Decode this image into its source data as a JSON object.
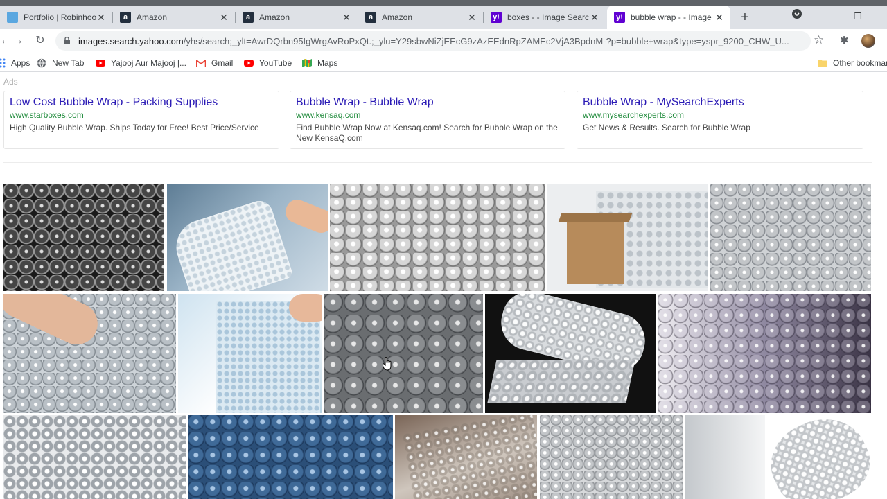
{
  "tabs": [
    {
      "title": "Portfolio | Robinhood",
      "favicon": "robinhood-favicon"
    },
    {
      "title": "Amazon",
      "favicon": "amazon-favicon"
    },
    {
      "title": "Amazon",
      "favicon": "amazon-favicon"
    },
    {
      "title": "Amazon",
      "favicon": "amazon-favicon"
    },
    {
      "title": "boxes - - Image Searc",
      "favicon": "yahoo-favicon"
    },
    {
      "title": "bubble wrap - - Image",
      "favicon": "yahoo-favicon",
      "active": true
    }
  ],
  "toolbar": {
    "url_host": "images.search.yahoo.com",
    "url_rest": "/yhs/search;_ylt=AwrDQrbn95IgWrgAvRoPxQt.;_ylu=Y29sbwNiZjEEcG9zAzEEdnRpZAMEc2VjA3BpdnM-?p=bubble+wrap&type=yspr_9200_CHW_U..."
  },
  "bookmarks": {
    "items": [
      {
        "label": "Apps",
        "icon": "apps-grid-icon"
      },
      {
        "label": "New Tab",
        "icon": "globe-icon"
      },
      {
        "label": "Yajooj Aur Majooj |...",
        "icon": "youtube-icon"
      },
      {
        "label": "Gmail",
        "icon": "gmail-icon"
      },
      {
        "label": "YouTube",
        "icon": "youtube-icon"
      },
      {
        "label": "Maps",
        "icon": "maps-icon"
      }
    ],
    "other": "Other bookmar"
  },
  "ads": {
    "label": "Ads",
    "items": [
      {
        "title": "Low Cost Bubble Wrap - Packing Supplies",
        "domain": "www.starboxes.com",
        "desc": "High Quality Bubble Wrap. Ships Today for Free! Best Price/Service"
      },
      {
        "title": "Bubble Wrap - Bubble Wrap",
        "domain": "www.kensaq.com",
        "desc": "Find Bubble Wrap Now at Kensaq.com! Search for Bubble Wrap on the New KensaQ.com"
      },
      {
        "title": "Bubble Wrap - MySearchExperts",
        "domain": "www.mysearchexperts.com",
        "desc": "Get News & Results. Search for Bubble Wrap"
      }
    ]
  },
  "colors": {
    "ad_title": "#2a1ab5",
    "ad_domain": "#1e8a3a",
    "yahoo_purple": "#6001d2",
    "tabbar": "#dee1e6"
  }
}
